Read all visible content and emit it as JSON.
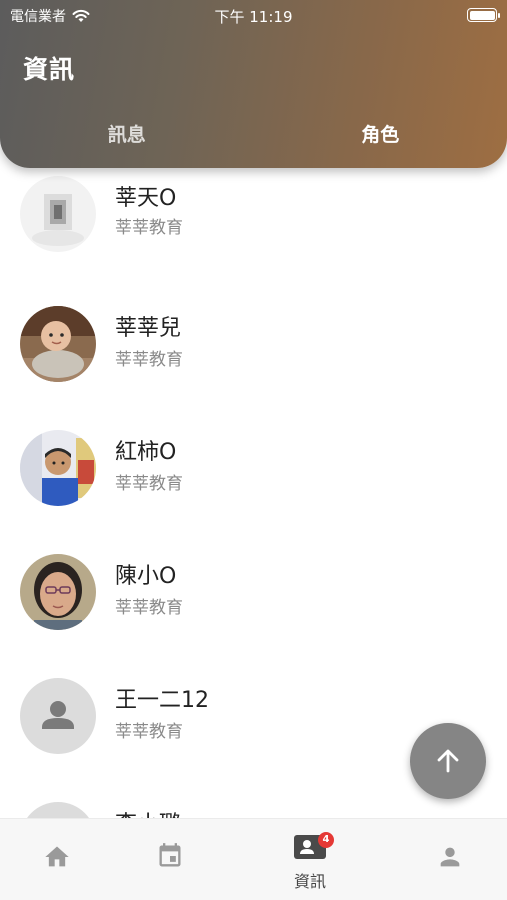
{
  "status_bar": {
    "carrier": "電信業者",
    "time": "下午 11:19"
  },
  "header": {
    "title": "資訊"
  },
  "tabs": [
    {
      "label": "訊息",
      "active": false
    },
    {
      "label": "角色",
      "active": true
    }
  ],
  "contacts": [
    {
      "name": "莘天O",
      "org": "莘莘教育",
      "avatar": "photo"
    },
    {
      "name": "莘莘兒",
      "org": "莘莘教育",
      "avatar": "photo"
    },
    {
      "name": "紅柿O",
      "org": "莘莘教育",
      "avatar": "photo"
    },
    {
      "name": "陳小O",
      "org": "莘莘教育",
      "avatar": "photo"
    },
    {
      "name": "王一二12",
      "org": "莘莘教育",
      "avatar": "placeholder-person-icon"
    },
    {
      "name": "李小璐",
      "org": "",
      "avatar": "placeholder-person-icon"
    }
  ],
  "fab": {
    "icon": "arrow-up-icon"
  },
  "bottom_nav": [
    {
      "icon": "home-icon",
      "label": ""
    },
    {
      "icon": "calendar-icon",
      "label": ""
    },
    {
      "icon": "contacts-icon",
      "label": "資訊",
      "badge": "4",
      "active": true
    },
    {
      "icon": "person-icon",
      "label": ""
    }
  ],
  "colors": {
    "header_start": "#5c5c5c",
    "header_end": "#9e6e42",
    "badge": "#e53935",
    "fab": "#858585"
  }
}
